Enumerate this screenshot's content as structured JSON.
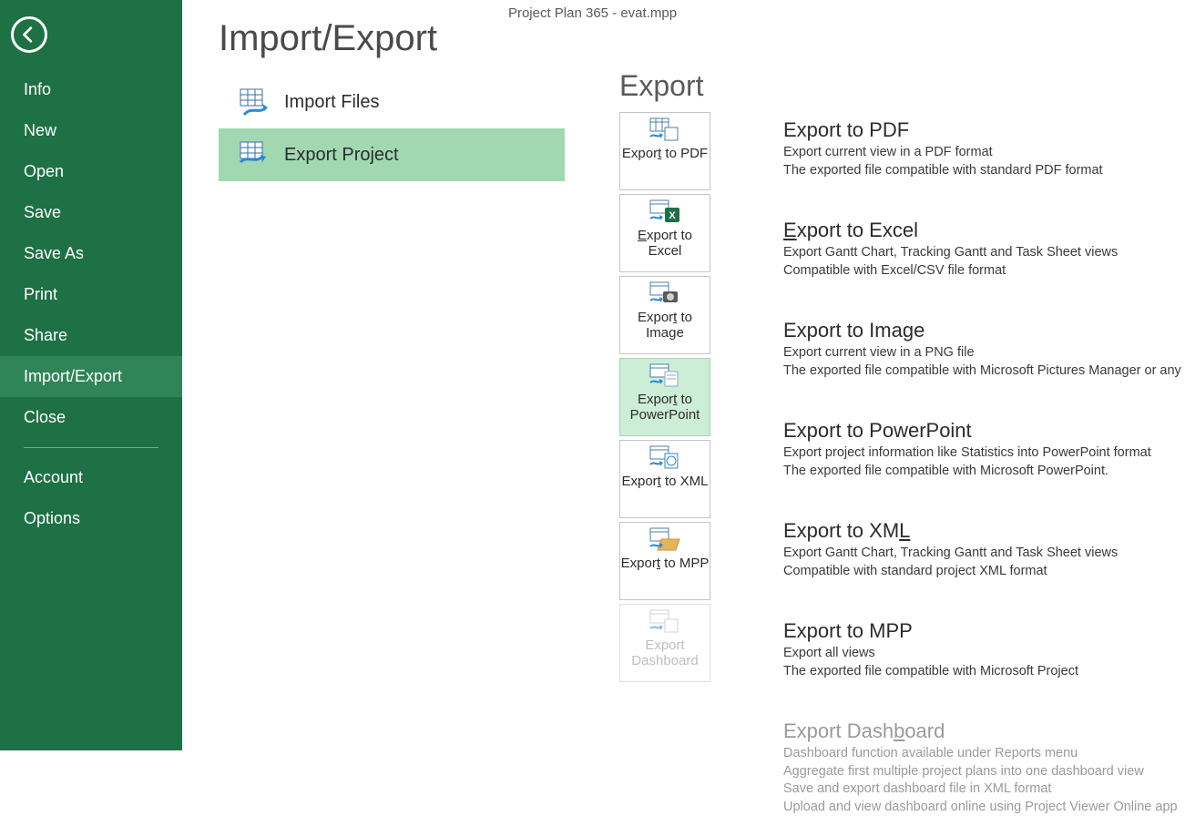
{
  "app_title": "Project Plan 365 - evat.mpp",
  "sidebar": {
    "items": [
      {
        "label": "Info",
        "selected": false
      },
      {
        "label": "New",
        "selected": false
      },
      {
        "label": "Open",
        "selected": false
      },
      {
        "label": "Save",
        "selected": false
      },
      {
        "label": "Save As",
        "selected": false
      },
      {
        "label": "Print",
        "selected": false
      },
      {
        "label": "Share",
        "selected": false
      },
      {
        "label": "Import/Export",
        "selected": true
      },
      {
        "label": "Close",
        "selected": false
      }
    ],
    "footer_items": [
      {
        "label": "Account"
      },
      {
        "label": "Options"
      }
    ]
  },
  "page": {
    "heading": "Import/Export",
    "actions": [
      {
        "id": "import-files",
        "label": "Import Files",
        "selected": false
      },
      {
        "id": "export-project",
        "label": "Export Project",
        "selected": true
      }
    ]
  },
  "export": {
    "heading": "Export",
    "tiles": [
      {
        "id": "pdf",
        "label_pre": "Expor",
        "label_u": "t",
        "label_post": " to PDF",
        "selected": false,
        "disabled": false
      },
      {
        "id": "excel",
        "label_pre": "",
        "label_u": "E",
        "label_post": "xport to Excel",
        "selected": false,
        "disabled": false
      },
      {
        "id": "image",
        "label_pre": "Expor",
        "label_u": "t",
        "label_post": " to Image",
        "selected": false,
        "disabled": false
      },
      {
        "id": "powerpoint",
        "label_pre": "Expor",
        "label_u": "t",
        "label_post": " to PowerPoint",
        "selected": true,
        "disabled": false
      },
      {
        "id": "xml",
        "label_pre": "Expor",
        "label_u": "t",
        "label_post": " to XML",
        "selected": false,
        "disabled": false
      },
      {
        "id": "mpp",
        "label_pre": "Expor",
        "label_u": "t",
        "label_post": " to MPP",
        "selected": false,
        "disabled": false
      },
      {
        "id": "dashboard",
        "label_pre": "Export Dashboard",
        "label_u": "",
        "label_post": "",
        "selected": false,
        "disabled": true
      }
    ],
    "descriptions": [
      {
        "id": "pdf",
        "title": "Export to PDF",
        "lines": [
          "Export current view in a PDF format",
          "The exported file compatible with standard PDF format"
        ],
        "disabled": false
      },
      {
        "id": "excel",
        "title_pre": "",
        "title_u": "E",
        "title_post": "xport to Excel",
        "lines": [
          "Export Gantt Chart, Tracking Gantt and Task Sheet views",
          "Compatible with Excel/CSV file format"
        ],
        "disabled": false
      },
      {
        "id": "image",
        "title": "Export to Image",
        "lines": [
          "Export current view in a PNG file",
          "The exported file compatible with Microsoft Pictures Manager or any viewer"
        ],
        "disabled": false
      },
      {
        "id": "powerpoint",
        "title": "Export to PowerPoint",
        "lines": [
          "Export project information like Statistics into PowerPoint format",
          "The exported file compatible with Microsoft PowerPoint."
        ],
        "disabled": false
      },
      {
        "id": "xml",
        "title_pre": "Export to XM",
        "title_u": "L",
        "title_post": "",
        "lines": [
          "Export Gantt Chart, Tracking Gantt and Task Sheet views",
          "Compatible with standard project XML format"
        ],
        "disabled": false
      },
      {
        "id": "mpp",
        "title": "Export to MPP",
        "lines": [
          "Export all views",
          "The exported file compatible with Microsoft Project"
        ],
        "disabled": false
      },
      {
        "id": "dashboard",
        "title_pre": "Export Dash",
        "title_u": "b",
        "title_post": "oard",
        "lines": [
          "Dashboard function available under Reports menu",
          "Aggregate first multiple project plans into one dashboard view",
          "Save and export dashboard file in XML format",
          "Upload and view dashboard online using Project Viewer Online app"
        ],
        "disabled": true
      }
    ]
  }
}
